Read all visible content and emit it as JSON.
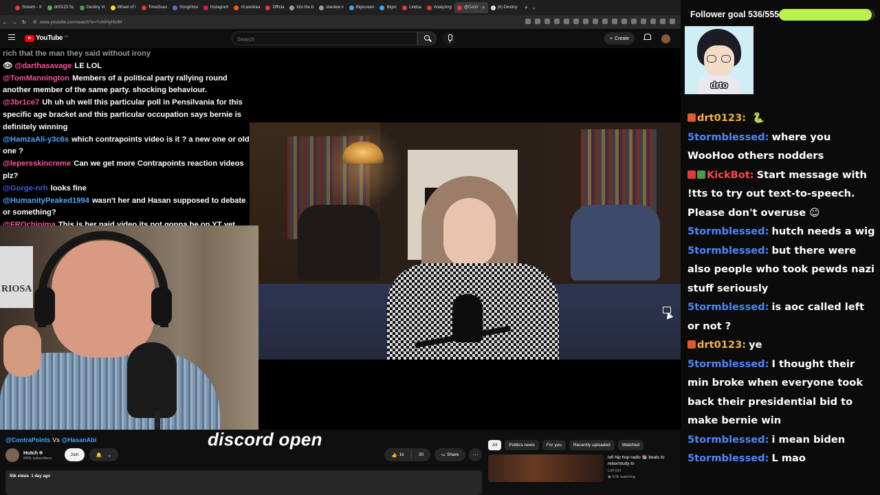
{
  "browser": {
    "tabs": [
      {
        "label": "Stream - X",
        "color": "#e53935"
      },
      {
        "label": "drt0123 Sc",
        "color": "#4caf50"
      },
      {
        "label": "Destiny Vi",
        "color": "#43a047"
      },
      {
        "label": "Wheel of I",
        "color": "#fdd835"
      },
      {
        "label": "TimeGues",
        "color": "#e53935"
      },
      {
        "label": "Songtrivia",
        "color": "#5c6bc0"
      },
      {
        "label": "Instagram",
        "color": "#d81b60"
      },
      {
        "label": "r/Livestrea",
        "color": "#ff5722"
      },
      {
        "label": "Officia",
        "color": "#e53935"
      },
      {
        "label": "into the b",
        "color": "#9e9e9e"
      },
      {
        "label": "stardew v",
        "color": "#9e9e9e"
      },
      {
        "label": "Bigscreen",
        "color": "#42a5f5"
      },
      {
        "label": "Bigsc",
        "color": "#42a5f5"
      },
      {
        "label": "Lindsa",
        "color": "#e53935"
      },
      {
        "label": "Analyzing",
        "color": "#e53935"
      },
      {
        "label": "@Contr",
        "color": "#e53935"
      },
      {
        "label": "(4) Destiny",
        "color": "#e0e0e0"
      }
    ],
    "active_tab": 15,
    "tab_close": "✕",
    "new_tab": "+",
    "tab_list": "⌄",
    "window_controls": {
      "minimize": "—",
      "maximize": "☐",
      "close": "✕"
    },
    "url": "www.youtube.com/watch?v=YcNXIyI8zlM",
    "nav": {
      "back": "←",
      "forward": "→",
      "reload": "↻"
    }
  },
  "youtube": {
    "logo_text": "YouTube",
    "country": "CA",
    "search_placeholder": "Search",
    "create_label": "Create",
    "create_plus": "+",
    "video": {
      "title_part1": "@ContraPoints",
      "title_vs": "Vs",
      "title_part2": "@HasanAbi",
      "channel_name": "Hutch",
      "channel_subs": "840k subscribers",
      "join_label": "Join",
      "likes": "1k",
      "dislikes": "30",
      "share_label": "Share",
      "more_label": "···",
      "views": "55k views",
      "posted": "1 day ago"
    },
    "caption": "discord open",
    "chips": [
      "All",
      "Politics news",
      "For you",
      "Recently uploaded",
      "Watched"
    ],
    "active_chip": 0,
    "recommended": {
      "title": "lofi hip hop radio 📚 beats to relax/study to",
      "channel": "Lofi Girl",
      "watching": "9.5k watching"
    }
  },
  "stream_chat": [
    {
      "user": "",
      "user_color": "#22c55e",
      "text": "",
      "partial": "rich that the man   they said without irony"
    },
    {
      "user": "@darthasavage",
      "user_color": "#ff4fa0",
      "text": "LE LOL",
      "icon": "👁"
    },
    {
      "user": "@TomMannington",
      "user_color": "#ff4fa0",
      "text": "Members of a political party rallying round another member of the same party. shocking behaviour."
    },
    {
      "user": "@3br1ce7",
      "user_color": "#ff4fa0",
      "text": "Uh uh uh well this particular poll in Pensilvania for this specific age bracket and this particular occupation says bernie is definitely winning"
    },
    {
      "user": "@HamzaAli-y3c6s",
      "user_color": "#4ea8ff",
      "text": "which contrapoints video is it ? a new one or old one ?"
    },
    {
      "user": "@lepersskincreme",
      "user_color": "#ff4fa0",
      "text": "Can we get more Contrapoints reaction videos plz?"
    },
    {
      "user": "@Gorge-nrh",
      "user_color": "#3b5bdb",
      "text": "looks fine"
    },
    {
      "user": "@HumanityPeaked1994",
      "user_color": "#4ea8ff",
      "text": "wasn't her and Hasan supposed to debate or something?"
    },
    {
      "user": "@FROchinima",
      "user_color": "#ff4fa0",
      "text": "This is her paid video its not gonna be on YT yet"
    }
  ],
  "webcam_poster_text": "RIOSA",
  "overlay": {
    "follower_goal_label": "Follower goal",
    "follower_current": 536,
    "follower_target": 555,
    "goal_fraction": 0.966,
    "goal_color": "#b9f24a",
    "avatar_name": "drto"
  },
  "chat_log": [
    {
      "user": "drt0123",
      "user_color": "#f4b23d",
      "text": "",
      "badge": "#e25a2b",
      "emote": "🐍",
      "partial_top": true
    },
    {
      "user": "5tormblessed",
      "user_color": "#4f86f7",
      "text": "where you WooHoo others nodders"
    },
    {
      "user": "KickBot",
      "user_color": "#ff4545",
      "text": "Start message with !tts to try out text-to-speech. Please don't overuse",
      "badges": [
        "#e53935",
        "#43a047"
      ],
      "emote": "☺"
    },
    {
      "user": "5tormblessed",
      "user_color": "#4f86f7",
      "text": "hutch needs a wig"
    },
    {
      "user": "5tormblessed",
      "user_color": "#4f86f7",
      "text": "but there were also people who took pewds nazi stuff seriously"
    },
    {
      "user": "5tormblessed",
      "user_color": "#4f86f7",
      "text": "is aoc called left or not ?"
    },
    {
      "user": "drt0123",
      "user_color": "#f4b23d",
      "text": "ye",
      "badge": "#e25a2b"
    },
    {
      "user": "5tormblessed",
      "user_color": "#4f86f7",
      "text": "I thought their min broke when everyone took back their presidential bid to make bernie win"
    },
    {
      "user": "5tormblessed",
      "user_color": "#4f86f7",
      "text": "i mean biden"
    },
    {
      "user": "5tormblessed",
      "user_color": "#4f86f7",
      "text": "L mao"
    }
  ]
}
